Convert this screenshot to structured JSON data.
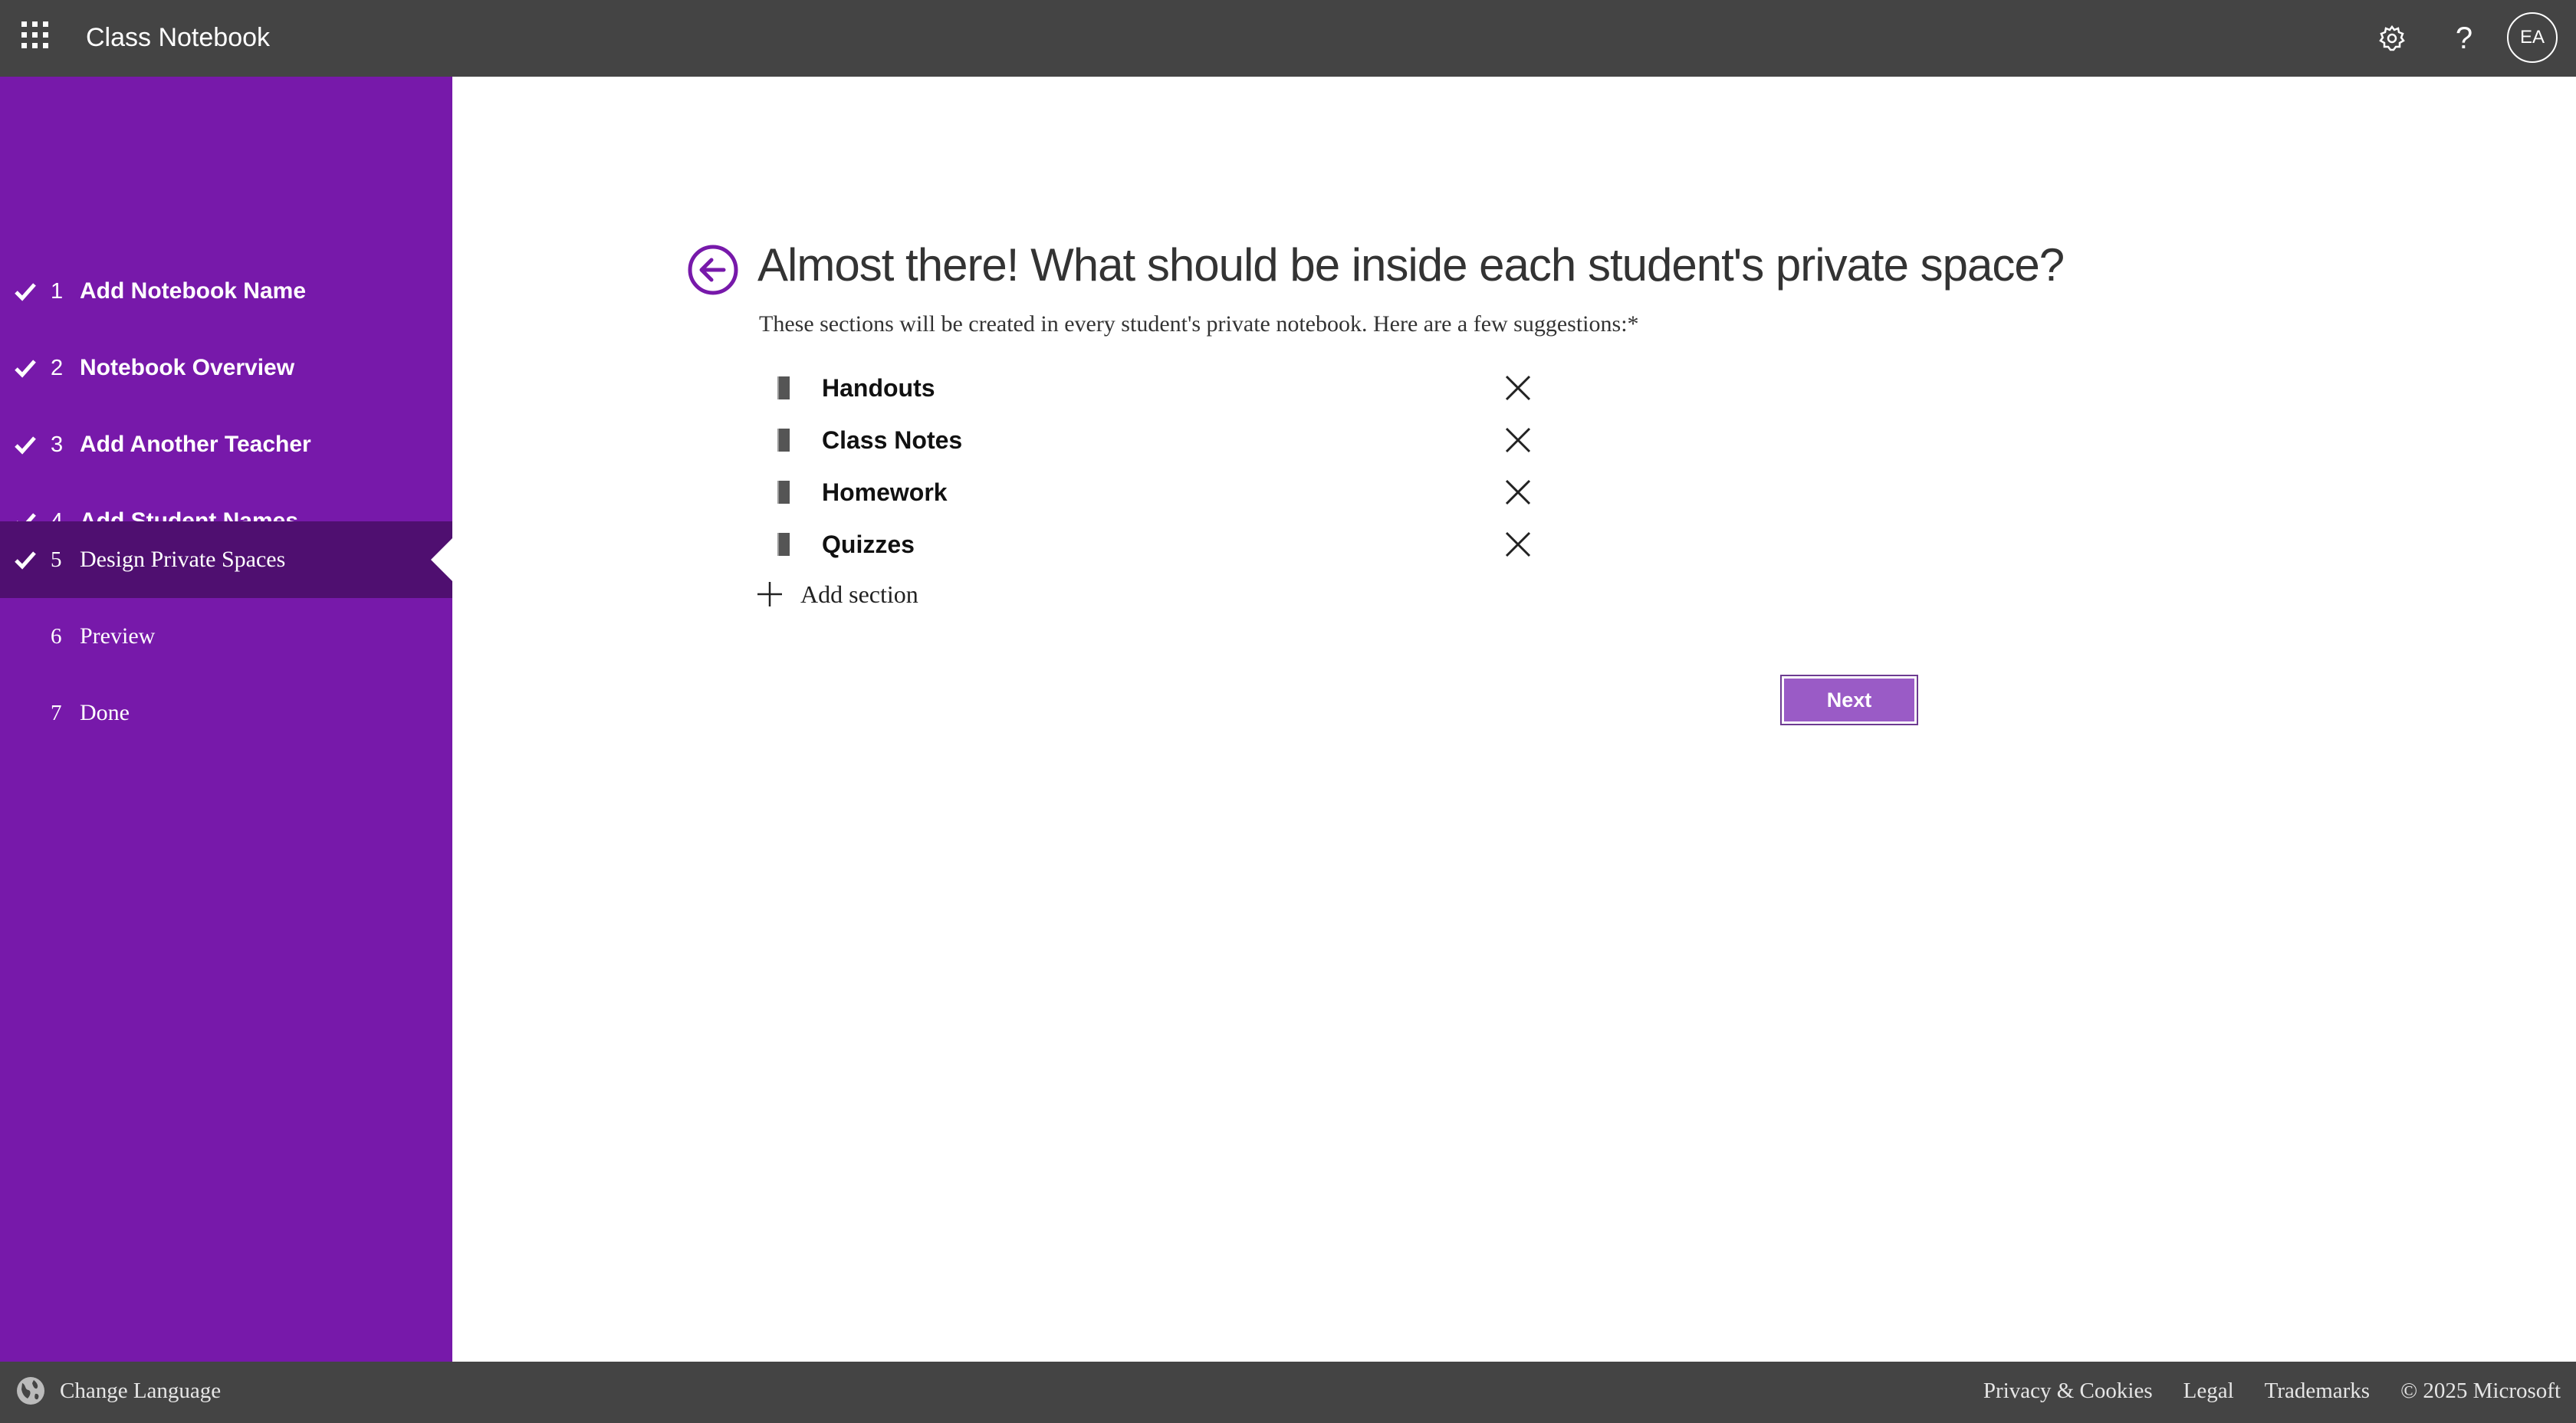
{
  "header": {
    "app_title": "Class Notebook",
    "avatar_initials": "EA",
    "help_glyph": "?",
    "icons": [
      "app-launcher-icon",
      "gear-icon",
      "help-icon"
    ]
  },
  "sidebar": {
    "steps": [
      {
        "number": "1",
        "label": "Add Notebook Name",
        "completed": true
      },
      {
        "number": "2",
        "label": "Notebook Overview",
        "completed": true
      },
      {
        "number": "3",
        "label": "Add Another Teacher",
        "completed": true
      },
      {
        "number": "4",
        "label": "Add Student Names",
        "completed": true
      },
      {
        "number": "5",
        "label": "Design Private Spaces",
        "completed": true,
        "active": true
      },
      {
        "number": "6",
        "label": "Preview",
        "completed": false
      },
      {
        "number": "7",
        "label": "Done",
        "completed": false
      }
    ],
    "background_color": "#7719aa",
    "active_color": "#4f0f70"
  },
  "main": {
    "heading": "Almost there! What should be inside each student's private space?",
    "subtext": "These sections will be created in every student's private notebook. Here are a few suggestions:*",
    "sections": [
      "Handouts",
      "Class Notes",
      "Homework",
      "Quizzes"
    ],
    "add_section_label": "Add section",
    "next_label": "Next",
    "accent_color": "#9a5bc6"
  },
  "footer": {
    "change_language": "Change Language",
    "privacy": "Privacy & Cookies",
    "legal": "Legal",
    "trademarks": "Trademarks",
    "copyright": "© 2025 Microsoft"
  }
}
